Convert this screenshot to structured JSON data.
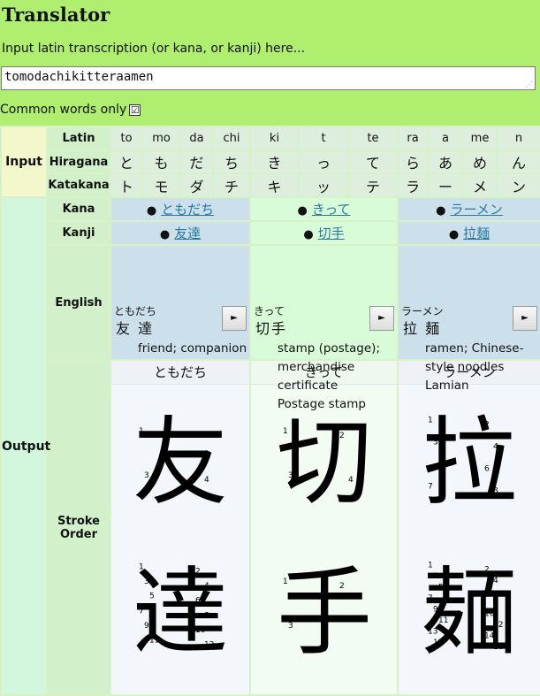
{
  "title": "Translator",
  "prompt": "Input latin transcription (or kana, or kanji) here...",
  "input_value": "tomodachikitteraamen",
  "common_label": "Common words only",
  "common_checked": "☑",
  "labels": {
    "input": "Input",
    "output": "Output",
    "latin": "Latin",
    "hiragana": "Hiragana",
    "katakana": "Katakana",
    "kana": "Kana",
    "kanji": "Kanji",
    "english": "English",
    "stroke_order": "Stroke Order"
  },
  "latin": [
    "to",
    "mo",
    "da",
    "chi",
    "ki",
    "t",
    "te",
    "ra",
    "a",
    "me",
    "n"
  ],
  "hiragana": [
    "と",
    "も",
    "だ",
    "ち",
    "き",
    "っ",
    "て",
    "ら",
    "あ",
    "め",
    "ん"
  ],
  "katakana": [
    "ト",
    "モ",
    "ダ",
    "チ",
    "キ",
    "ッ",
    "テ",
    "ラ",
    "ー",
    "メ",
    "ン"
  ],
  "words": [
    {
      "kana": "ともだち",
      "kanji": "友達",
      "furigana": "ともだち",
      "kanji_spaced": "友 達",
      "glosses": [
        "friend; companion"
      ],
      "stroke_header": "ともだち",
      "chars": [
        {
          "char": "友",
          "nums": [
            "1",
            "2",
            "3",
            "4"
          ]
        },
        {
          "char": "達",
          "nums": [
            "1",
            "2",
            "3",
            "4",
            "5",
            "6",
            "7",
            "8",
            "9",
            "10",
            "11",
            "12"
          ]
        }
      ]
    },
    {
      "kana": "きって",
      "kanji": "切手",
      "furigana": "きって",
      "kanji_spaced": "切手",
      "glosses": [
        "stamp (postage);",
        "merchandise",
        "certificate",
        "Postage stamp"
      ],
      "stroke_header": "きって",
      "chars": [
        {
          "char": "切",
          "nums": [
            "1",
            "2",
            "3",
            "4"
          ]
        },
        {
          "char": "手",
          "nums": [
            "1",
            "2",
            "3"
          ]
        }
      ]
    },
    {
      "kana": "ラーメン",
      "kanji": "拉麺",
      "furigana": "ラーメン",
      "kanji_spaced": "拉 麺",
      "glosses": [
        "ramen; Chinese-",
        "style noodles",
        "Lamian"
      ],
      "stroke_header": "ラーメン",
      "chars": [
        {
          "char": "拉",
          "nums": [
            "1",
            "2",
            "3",
            "4",
            "5",
            "6",
            "7",
            "8"
          ]
        },
        {
          "char": "麺",
          "nums": [
            "1",
            "2",
            "3",
            "4",
            "5",
            "6",
            "7",
            "8",
            "9",
            "10",
            "11",
            "12",
            "13",
            "14",
            "15",
            "16"
          ]
        }
      ]
    }
  ],
  "play_icon": "►"
}
